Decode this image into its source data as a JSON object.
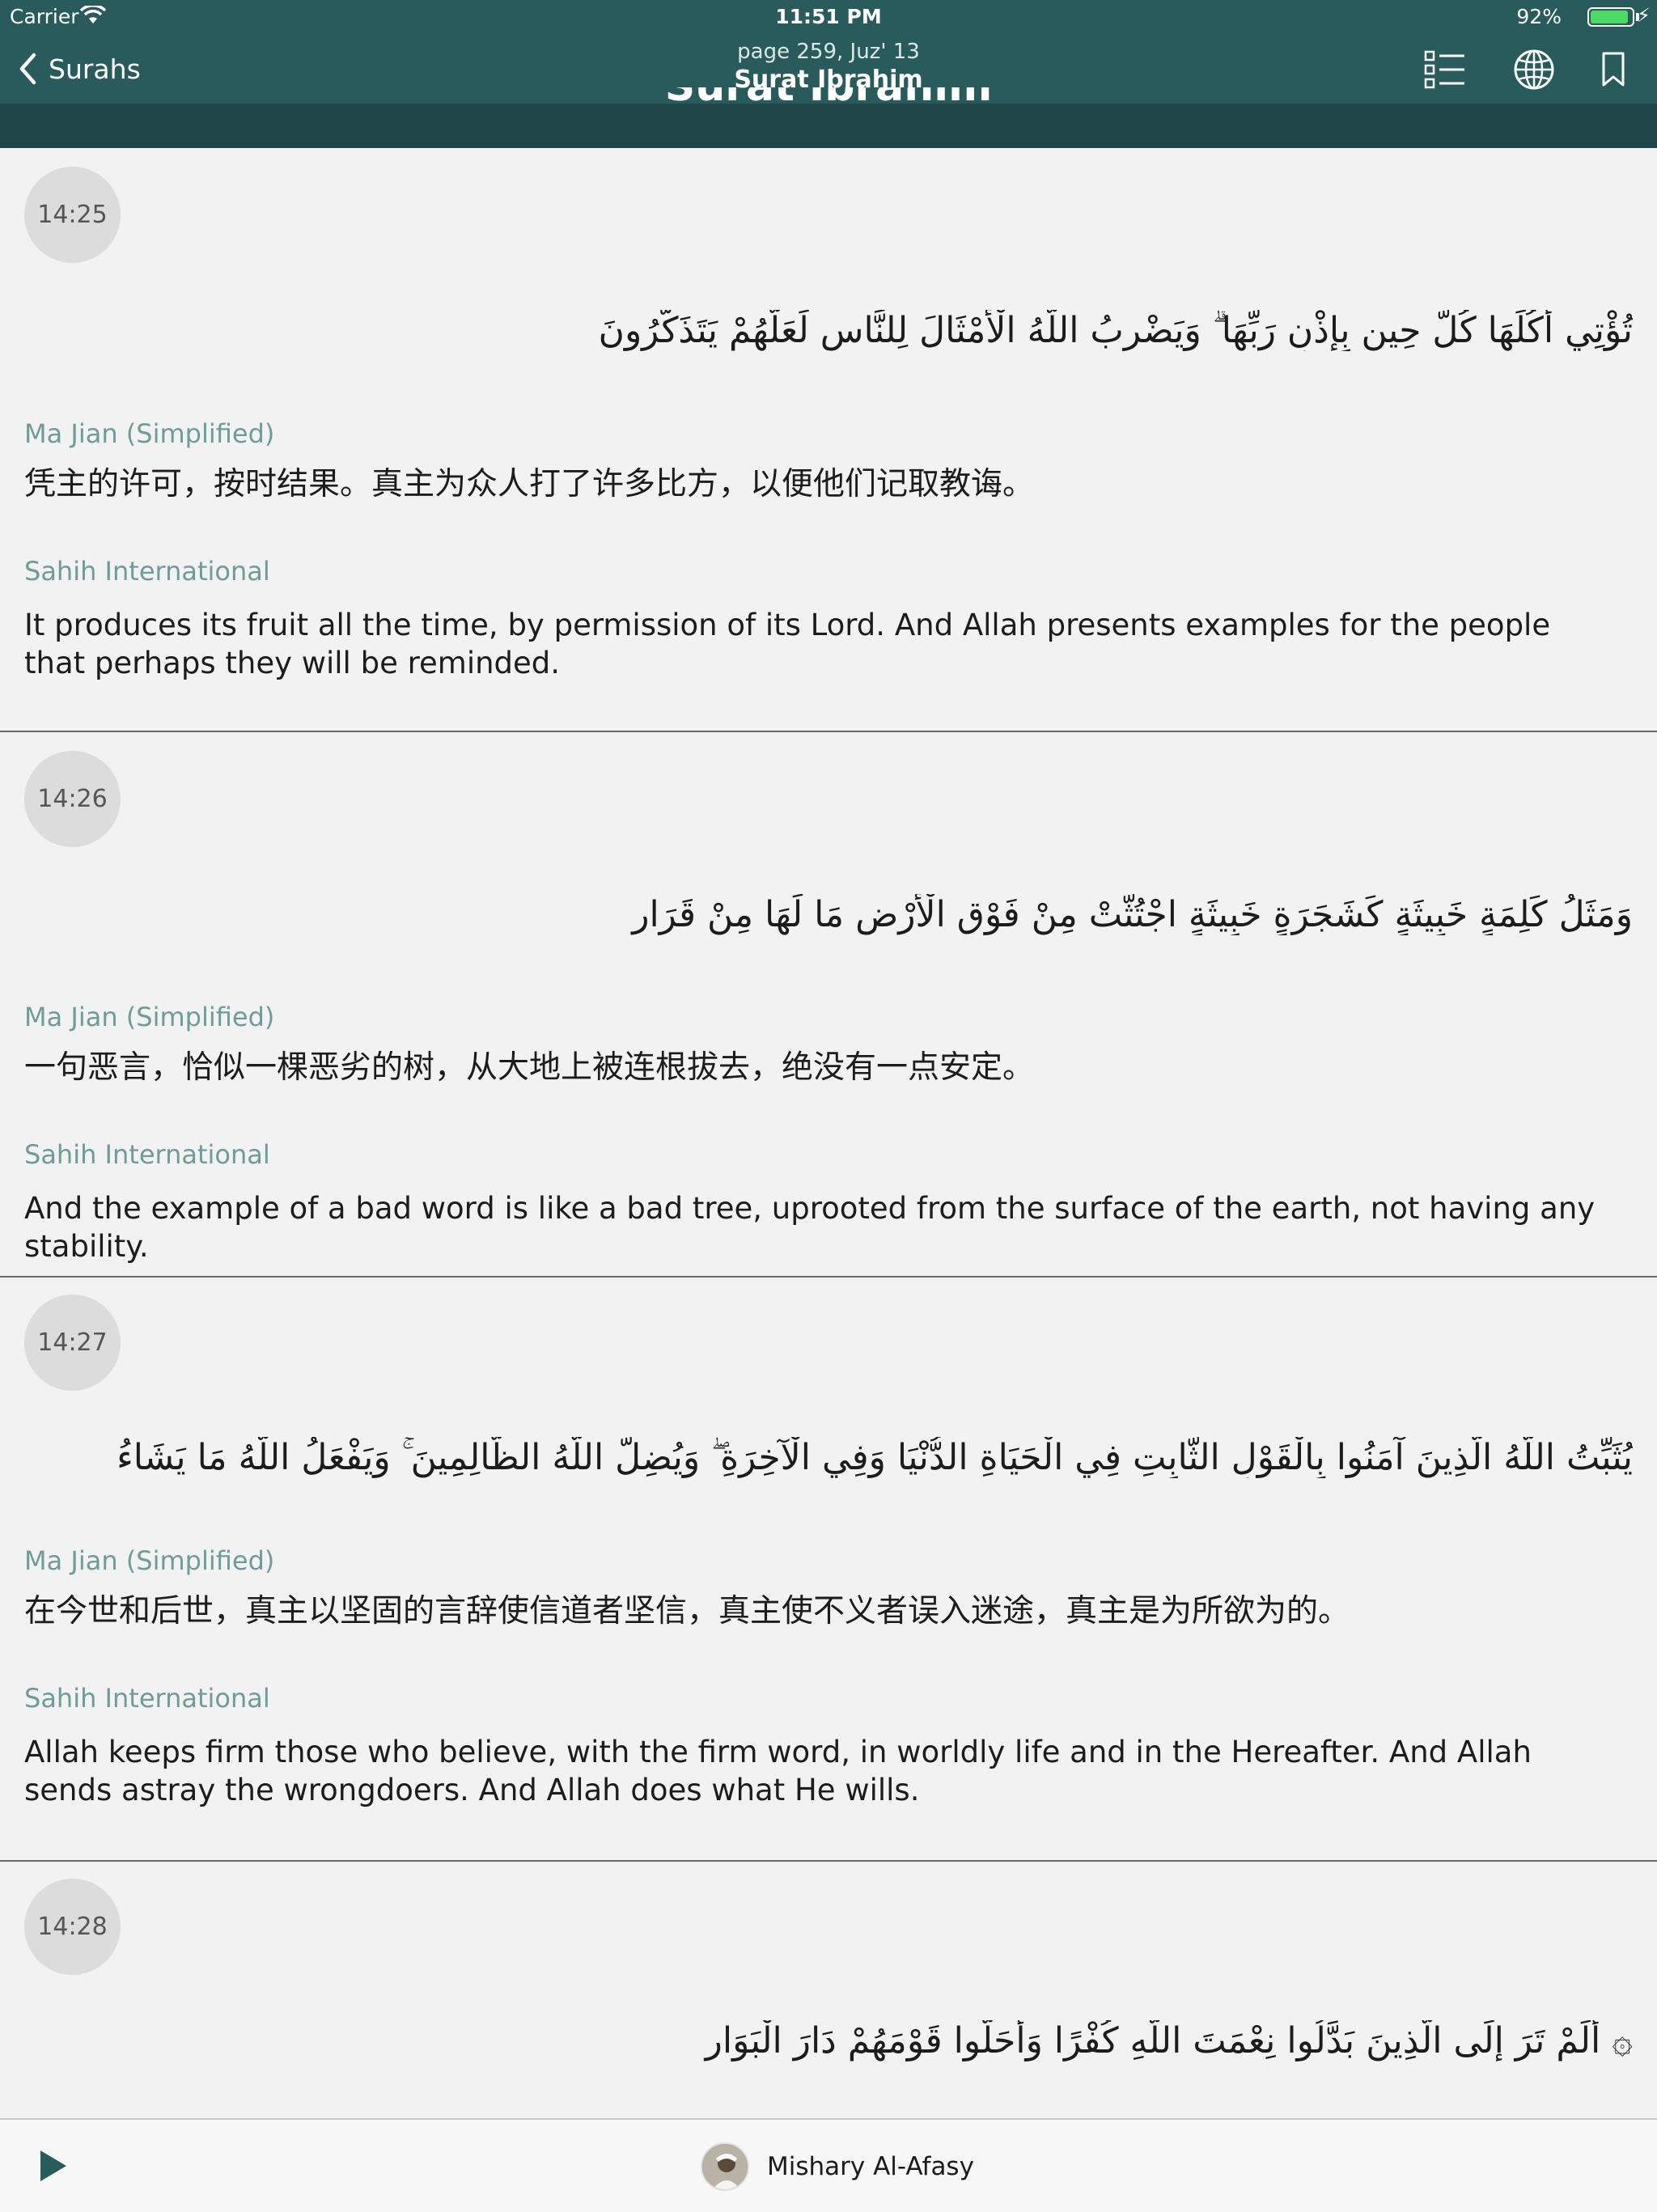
{
  "status_bar": {
    "carrier": "Carrier",
    "time": "11:51 PM",
    "battery_percent": "92%",
    "battery_level": 0.92
  },
  "nav": {
    "back_label": "Surahs",
    "subtitle": "page 259, Juz' 13",
    "title": "Surat Ibrahim",
    "ghost_title": "Surat Ibrahim",
    "icons": [
      "list-icon",
      "globe-icon",
      "bookmark-icon"
    ]
  },
  "verses": [
    {
      "number": "14:25",
      "arabic": "تُؤْتِي أُكُلَهَا كُلَّ حِينٍ بِإِذْنِ رَبِّهَا ۗ وَيَضْرِبُ اللَّهُ الْأَمْثَالَ لِلنَّاسِ لَعَلَّهُمْ يَتَذَكَّرُونَ",
      "translations": [
        {
          "name": "Ma Jian (Simplified)",
          "text": "凭主的许可，按时结果。真主为众人打了许多比方，以便他们记取教诲。"
        },
        {
          "name": "Sahih International",
          "text": "It produces its fruit all the time, by permission of its Lord. And Allah presents examples for the people that perhaps they will be reminded."
        }
      ]
    },
    {
      "number": "14:26",
      "arabic": "وَمَثَلُ كَلِمَةٍ خَبِيثَةٍ كَشَجَرَةٍ خَبِيثَةٍ اجْتُثَّتْ مِنْ فَوْقِ الْأَرْضِ مَا لَهَا مِنْ قَرَارٍ",
      "translations": [
        {
          "name": "Ma Jian (Simplified)",
          "text": "一句恶言，恰似一棵恶劣的树，从大地上被连根拔去，绝没有一点安定。"
        },
        {
          "name": "Sahih International",
          "text": "And the example of a bad word is like a bad tree, uprooted from the surface of the earth, not having any stability."
        }
      ]
    },
    {
      "number": "14:27",
      "arabic": "يُثَبِّتُ اللَّهُ الَّذِينَ آمَنُوا بِالْقَوْلِ الثَّابِتِ فِي الْحَيَاةِ الدُّنْيَا وَفِي الْآخِرَةِ ۖ وَيُضِلُّ اللَّهُ الظَّالِمِينَ ۚ وَيَفْعَلُ اللَّهُ مَا يَشَاءُ",
      "translations": [
        {
          "name": "Ma Jian (Simplified)",
          "text": "在今世和后世，真主以坚固的言辞使信道者坚信，真主使不义者误入迷途，真主是为所欲为的。"
        },
        {
          "name": "Sahih International",
          "text": "Allah keeps firm those who believe, with the firm word, in worldly life and in the Hereafter. And Allah sends astray the wrongdoers. And Allah does what He wills."
        }
      ]
    },
    {
      "number": "14:28",
      "arabic": "۞ أَلَمْ تَرَ إِلَى الَّذِينَ بَدَّلُوا نِعْمَتَ اللَّهِ كُفْرًا وَأَحَلُّوا قَوْمَهُمْ دَارَ الْبَوَارِ",
      "translations": []
    }
  ],
  "player": {
    "reciter": "Mishary Al-Afasy",
    "play_icon": "play-icon",
    "avatar_icon": "reciter-avatar"
  },
  "colors": {
    "header": "#2a5b5c",
    "header_shade": "#1f4748",
    "accent_label": "#6f9b98",
    "background": "#f2f2f2",
    "play": "#2a5b5c"
  }
}
